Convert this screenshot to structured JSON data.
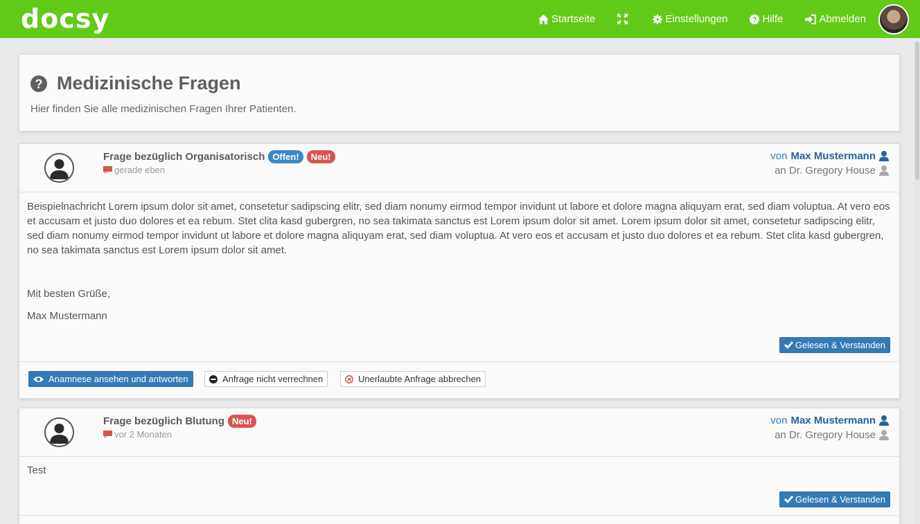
{
  "app": {
    "logo_text": "docsy"
  },
  "nav": {
    "home_label": "Startseite",
    "settings_label": "Einstellungen",
    "help_label": "Hilfe",
    "logout_label": "Abmelden"
  },
  "page": {
    "title": "Medizinische Fragen",
    "subtitle": "Hier finden Sie alle medizinischen Fragen Ihrer Patienten."
  },
  "questions": [
    {
      "title": "Frage bezüglich Organisatorisch",
      "badge_open": "Offen!",
      "badge_new": "Neu!",
      "time": "gerade eben",
      "from_prefix": "von",
      "from_name": "Max Mustermann",
      "to": "an Dr. Gregory House",
      "body_paragraph": "Beispielnachricht Lorem ipsum dolor sit amet, consetetur sadipscing elitr, sed diam nonumy eirmod tempor invidunt ut labore et dolore magna aliquyam erat, sed diam voluptua. At vero eos et accusam et justo duo dolores et ea rebum. Stet clita kasd gubergren, no sea takimata sanctus est Lorem ipsum dolor sit amet. Lorem ipsum dolor sit amet, consetetur sadipscing elitr, sed diam nonumy eirmod tempor invidunt ut labore et dolore magna aliquyam erat, sed diam voluptua. At vero eos et accusam et justo duo dolores et ea rebum. Stet clita kasd gubergren, no sea takimata sanctus est Lorem ipsum dolor sit amet.",
      "greeting": "Mit besten Grüße,",
      "signature": "Max Mustermann",
      "read_button": "Gelesen & Verstanden",
      "actions": {
        "view_answer": "Anamnese ansehen und antworten",
        "no_bill": "Anfrage nicht verrechnen",
        "cancel": "Unerlaubte Anfrage abbrechen"
      }
    },
    {
      "title": "Frage bezüglich Blutung",
      "badge_new": "Neu!",
      "time": "vor 2 Monaten",
      "from_prefix": "von",
      "from_name": "Max Mustermann",
      "to": "an Dr. Gregory House",
      "body_paragraph": "Test",
      "read_button": "Gelesen & Verstanden"
    }
  ],
  "colors": {
    "navbar": "#62cb17",
    "primary": "#337ab7",
    "danger": "#d9534f"
  }
}
